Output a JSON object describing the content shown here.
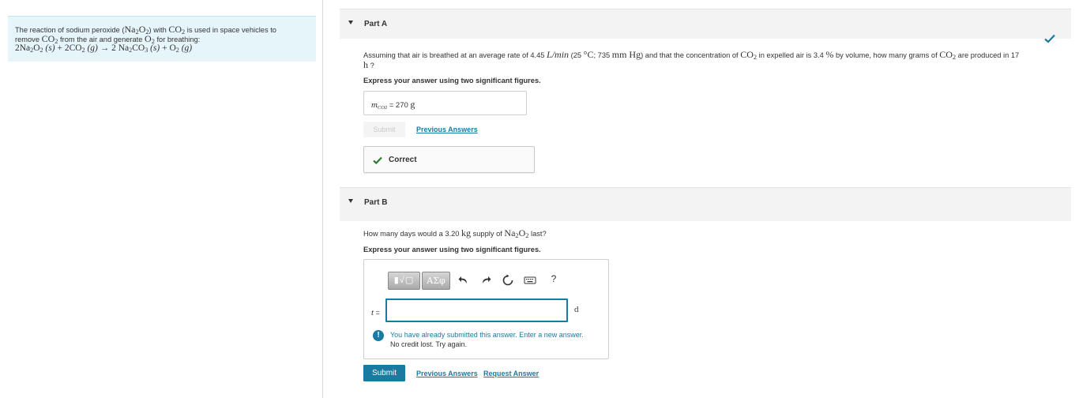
{
  "problem": {
    "intro_line1": "The reaction of sodium peroxide (",
    "intro_line1_end": ") with ",
    "intro_line1_tail": " is used in space vehicles to",
    "intro_line2_pre": "remove ",
    "intro_line2_mid": " from the air and generate ",
    "intro_line2_end": " for breathing:",
    "species": {
      "na": "Na",
      "o": "O",
      "c": "C",
      "co": "CO",
      "co3": "CO",
      "sub2": "2",
      "sub3": "3"
    },
    "equation": {
      "coef2": "2",
      "s_phase": "(s)",
      "g_phase": "(g)",
      "plus": "+",
      "arrow": "→",
      "coef_2co2": "2",
      "coef_2na": "2"
    }
  },
  "part_a": {
    "title": "Part A",
    "question_pre": "Assuming that air is breathed at an average rate of 4.45 ",
    "rate_unit": "L/min",
    "cond_open": " (25 ",
    "deg_c": "°C",
    "cond_sep": "; 735 ",
    "mmhg": "mm Hg",
    "question_mid": ") and that the concentration of ",
    "question_mid2": " in expelled air is 3.4 ",
    "percent": "%",
    "question_mid3": " by volume, how many grams of ",
    "question_end": " are produced in 17",
    "line2_unit": "h",
    "line2_q": " ?",
    "instruction": "Express your answer using two significant figures.",
    "answer_var": "m",
    "answer_sub": "CO",
    "answer_sub2": "2",
    "answer_eq": " = ",
    "answer_value": "270",
    "answer_unit": "g",
    "submit_label": "Submit",
    "previous_answers": "Previous Answers",
    "correct_label": "Correct"
  },
  "part_b": {
    "title": "Part B",
    "question_pre": "How many days would a 3.20 ",
    "kg": "kg",
    "question_mid": " supply of ",
    "question_end": " last?",
    "instruction": "Express your answer using two significant figures.",
    "toolbar": {
      "templates": "▮√▢",
      "greek": "ΑΣφ",
      "help": "?"
    },
    "var_label": "t",
    "var_eq": " =",
    "unit": "d",
    "warning_icon": "!",
    "warning_line1": "You have already submitted this answer. Enter a new answer.",
    "warning_line2": "No credit lost. Try again.",
    "submit_label": "Submit",
    "previous_answers": "Previous Answers",
    "request_answer": "Request Answer"
  },
  "colors": {
    "accent": "#1a7aa0",
    "check_green": "#2e7d32",
    "intro_bg": "#e6f5fa"
  }
}
